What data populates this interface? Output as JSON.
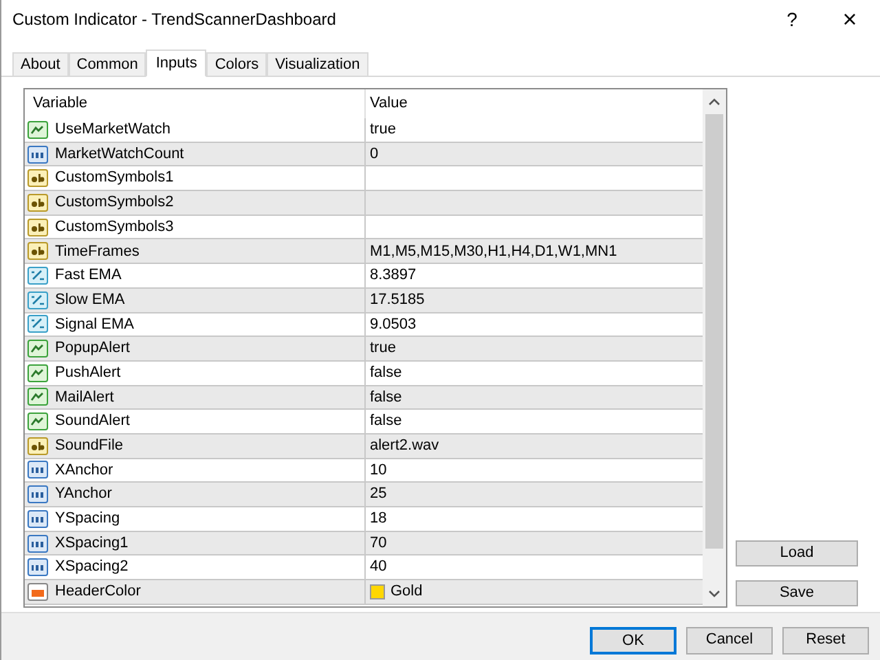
{
  "window": {
    "title": "Custom Indicator - TrendScannerDashboard",
    "help": "?",
    "close": "×"
  },
  "tabs": [
    {
      "label": "About",
      "selected": false
    },
    {
      "label": "Common",
      "selected": false
    },
    {
      "label": "Inputs",
      "selected": true
    },
    {
      "label": "Colors",
      "selected": false
    },
    {
      "label": "Visualization",
      "selected": false
    }
  ],
  "table": {
    "columns": [
      "Variable",
      "Value"
    ],
    "rows": [
      {
        "kind": "bool",
        "variable": "UseMarketWatch",
        "value": "true"
      },
      {
        "kind": "int",
        "variable": "MarketWatchCount",
        "value": "0"
      },
      {
        "kind": "string",
        "variable": "CustomSymbols1",
        "value": ""
      },
      {
        "kind": "string",
        "variable": "CustomSymbols2",
        "value": ""
      },
      {
        "kind": "string",
        "variable": "CustomSymbols3",
        "value": ""
      },
      {
        "kind": "string",
        "variable": "TimeFrames",
        "value": "M1,M5,M15,M30,H1,H4,D1,W1,MN1"
      },
      {
        "kind": "double",
        "variable": "Fast EMA",
        "value": "8.3897"
      },
      {
        "kind": "double",
        "variable": "Slow EMA",
        "value": "17.5185"
      },
      {
        "kind": "double",
        "variable": "Signal EMA",
        "value": "9.0503"
      },
      {
        "kind": "bool",
        "variable": "PopupAlert",
        "value": "true"
      },
      {
        "kind": "bool",
        "variable": "PushAlert",
        "value": "false"
      },
      {
        "kind": "bool",
        "variable": "MailAlert",
        "value": "false"
      },
      {
        "kind": "bool",
        "variable": "SoundAlert",
        "value": "false"
      },
      {
        "kind": "string",
        "variable": "SoundFile",
        "value": "alert2.wav"
      },
      {
        "kind": "int",
        "variable": "XAnchor",
        "value": "10"
      },
      {
        "kind": "int",
        "variable": "YAnchor",
        "value": "25"
      },
      {
        "kind": "int",
        "variable": "YSpacing",
        "value": "18"
      },
      {
        "kind": "int",
        "variable": "XSpacing1",
        "value": "70"
      },
      {
        "kind": "int",
        "variable": "XSpacing2",
        "value": "40"
      },
      {
        "kind": "color",
        "variable": "HeaderColor",
        "value": "Gold",
        "color": "#ffd700"
      }
    ]
  },
  "side_buttons": [
    "Load",
    "Save"
  ],
  "buttons": [
    {
      "label": "OK",
      "default": true
    },
    {
      "label": "Cancel",
      "default": false
    },
    {
      "label": "Reset",
      "default": false
    }
  ]
}
